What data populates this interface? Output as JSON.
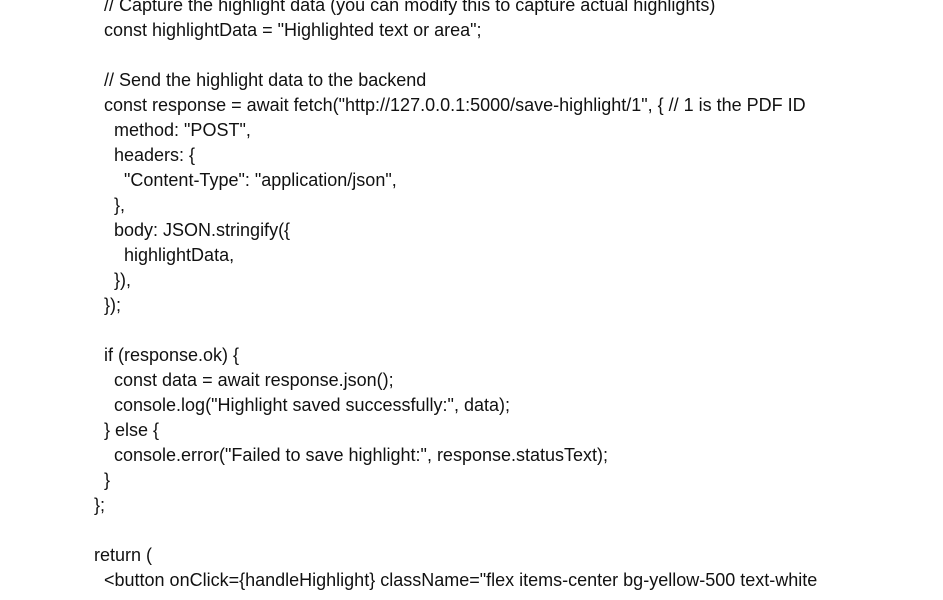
{
  "document": {
    "lines": [
      "    // Capture the highlight data (you can modify this to capture actual highlights)",
      "    const highlightData = \"Highlighted text or area\";",
      "",
      "    // Send the highlight data to the backend",
      "    const response = await fetch(\"http://127.0.0.1:5000/save-highlight/1\", { // 1 is the PDF ID",
      "      method: \"POST\",",
      "      headers: {",
      "        \"Content-Type\": \"application/json\",",
      "      },",
      "      body: JSON.stringify({",
      "        highlightData,",
      "      }),",
      "    });",
      "",
      "    if (response.ok) {",
      "      const data = await response.json();",
      "      console.log(\"Highlight saved successfully:\", data);",
      "    } else {",
      "      console.error(\"Failed to save highlight:\", response.statusText);",
      "    }",
      "  };",
      "",
      "  return (",
      "    <button onClick={handleHighlight} className=\"flex items-center bg-yellow-500 text-white"
    ]
  }
}
